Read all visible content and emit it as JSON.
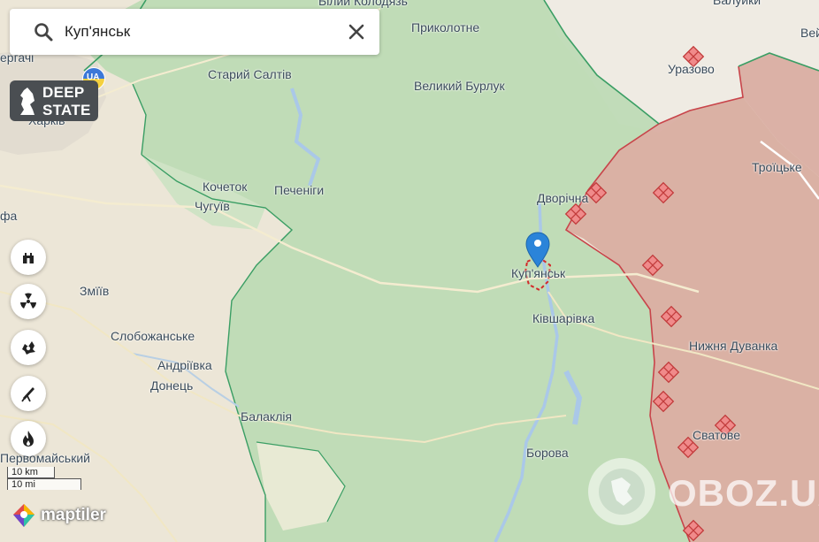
{
  "search": {
    "query": "Куп'янськ",
    "icon": "search-icon",
    "clear_icon": "close-icon"
  },
  "logo": {
    "line1": "DEEP",
    "line2": "STATE",
    "badge": "UA",
    "icon": "horse-knight-icon"
  },
  "towns": [
    {
      "name": "Білий Колодязь"
    },
    {
      "name": "Валуйки"
    },
    {
      "name": "Вей"
    },
    {
      "name": "Приколотне"
    },
    {
      "name": "Уразово"
    },
    {
      "name": "Старий Салтів"
    },
    {
      "name": "Великий Бурлук"
    },
    {
      "name": "ергачі"
    },
    {
      "name": "Харків"
    },
    {
      "name": "Троїцьке"
    },
    {
      "name": "Кочеток"
    },
    {
      "name": "Печеніги"
    },
    {
      "name": "Чугуїв"
    },
    {
      "name": "Дворічна"
    },
    {
      "name": "фа"
    },
    {
      "name": "Куп'янськ"
    },
    {
      "name": "Змїїв"
    },
    {
      "name": "Ківшарівка"
    },
    {
      "name": "Слобожанське"
    },
    {
      "name": "Нижня Дуванка"
    },
    {
      "name": "Андріївка"
    },
    {
      "name": "Донець"
    },
    {
      "name": "Балаклія"
    },
    {
      "name": "Сватове"
    },
    {
      "name": "Борова"
    },
    {
      "name": "Первомайський"
    }
  ],
  "tools": [
    {
      "icon": "fortification-icon"
    },
    {
      "icon": "radiation-icon"
    },
    {
      "icon": "explosion-icon"
    },
    {
      "icon": "missile-launcher-icon"
    },
    {
      "icon": "fire-icon"
    }
  ],
  "scale": {
    "metric": "10 km",
    "imperial": "10 mi"
  },
  "attribution": {
    "maptiler": "maptiler"
  },
  "watermark": {
    "text": "OBOZ.UA"
  },
  "colors": {
    "controlled_zone": "#a9d3a6",
    "occupied_zone": "#dcaaa4",
    "occupied_border": "#c8444a",
    "water": "#aac8e8",
    "marker": "#2b84d9",
    "ukraine_border": "#3a9e64"
  }
}
